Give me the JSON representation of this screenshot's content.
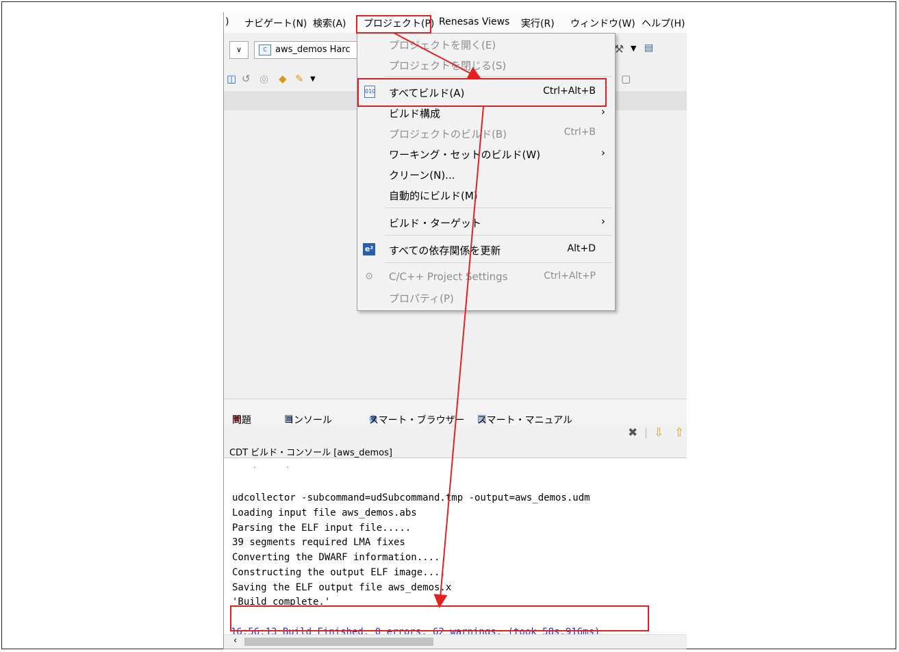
{
  "menubar": {
    "items": [
      "ナビゲート(N)",
      "検索(A)",
      "プロジェクト(P)",
      "Renesas Views",
      "実行(R)",
      "ウィンドウ(W)",
      "ヘルプ(H)"
    ],
    "partial_left": ")"
  },
  "toolbar": {
    "combo_value": "aws_demos Harc"
  },
  "project_menu": {
    "items": [
      {
        "label": "プロジェクトを開く(E)",
        "shortcut": "",
        "enabled": false
      },
      {
        "label": "プロジェクトを閉じる(S)",
        "shortcut": "",
        "enabled": false
      },
      {
        "label": "すべてビルド(A)",
        "shortcut": "Ctrl+Alt+B",
        "enabled": true,
        "icon": "build-all-icon"
      },
      {
        "label": "ビルド構成",
        "shortcut": "",
        "enabled": true,
        "submenu": true
      },
      {
        "label": "プロジェクトのビルド(B)",
        "shortcut": "Ctrl+B",
        "enabled": false
      },
      {
        "label": "ワーキング・セットのビルド(W)",
        "shortcut": "",
        "enabled": true,
        "submenu": true
      },
      {
        "label": "クリーン(N)...",
        "shortcut": "",
        "enabled": true
      },
      {
        "label": "自動的にビルド(M)",
        "shortcut": "",
        "enabled": true
      },
      {
        "label": "ビルド・ターゲット",
        "shortcut": "",
        "enabled": true,
        "submenu": true
      },
      {
        "label": "すべての依存関係を更新",
        "shortcut": "Alt+D",
        "enabled": true,
        "icon": "e2-icon"
      },
      {
        "label": "C/C++ Project Settings",
        "shortcut": "Ctrl+Alt+P",
        "enabled": false,
        "icon": "settings-icon"
      },
      {
        "label": "プロパティ(P)",
        "shortcut": "",
        "enabled": false
      }
    ],
    "submenu_arrow": "›",
    "e2_icon_text": "e²",
    "build_icon_text": "010"
  },
  "views": {
    "tabs": [
      "問題",
      "コンソール",
      "スマート・ブラウザー",
      "スマート・マニュアル"
    ],
    "close_mark": "⊠"
  },
  "console": {
    "title": "CDT ビルド・コンソール [aws_demos]",
    "lines": [
      "udcollector -subcommand=udSubcommand.tmp -output=aws_demos.udm",
      "Loading input file aws_demos.abs",
      "Parsing the ELF input file.....",
      "39 segments required LMA fixes",
      "Converting the DWARF information....",
      "Constructing the output ELF image....",
      "Saving the ELF output file aws_demos.x",
      "'Build complete.'"
    ],
    "result": "16:56:13 Build Finished. 0 errors, 62 warnings. (took 58s.916ms)"
  },
  "colors": {
    "highlight": "#e32020",
    "result_text": "#1a33d6"
  }
}
